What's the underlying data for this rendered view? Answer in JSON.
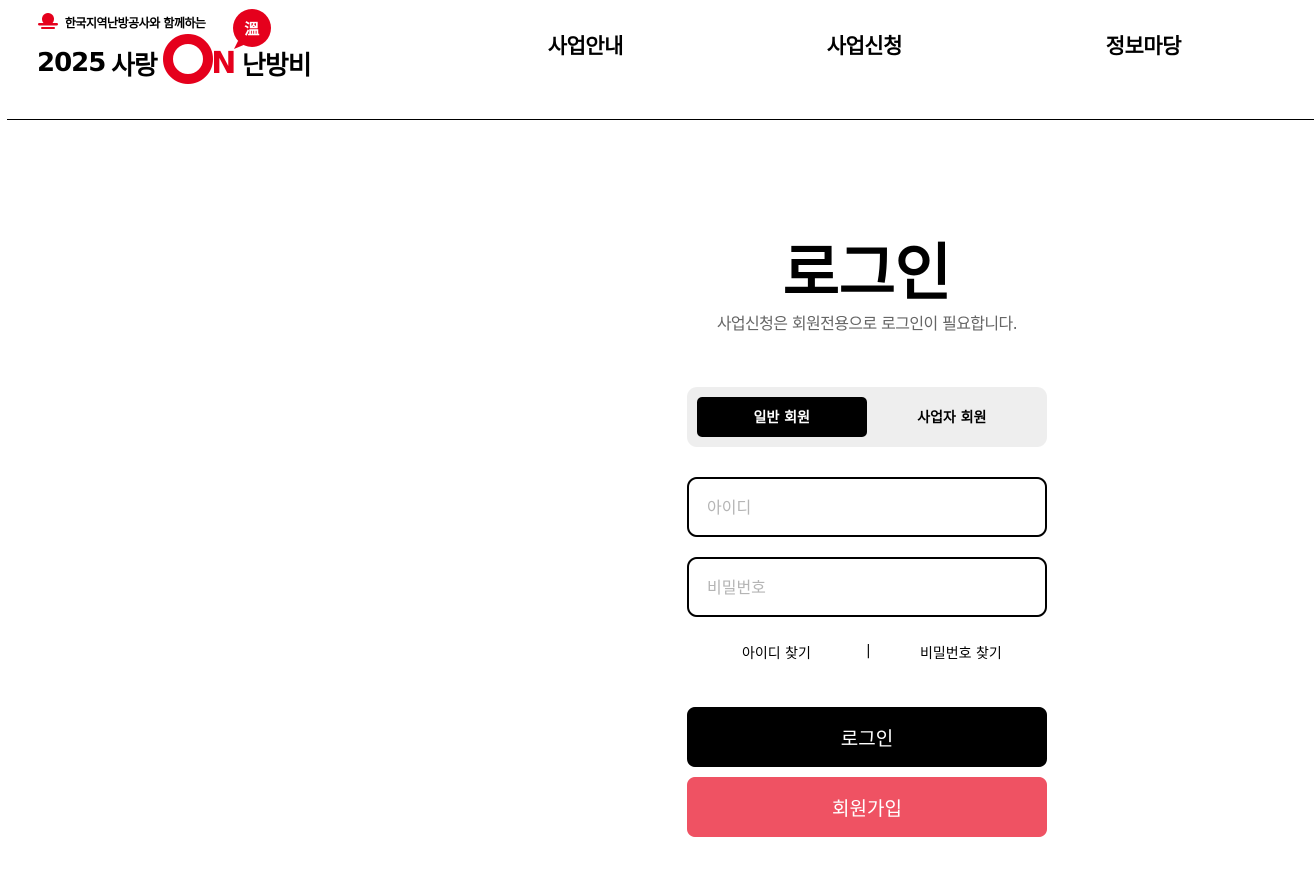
{
  "header": {
    "logo": {
      "subtitle": "한국지역난방공사와 함께하는",
      "year": "2025",
      "love": "사랑",
      "on_letter": "N",
      "heating": "난방비",
      "bubble_char": "溫",
      "brand_red": "#e5001c"
    },
    "nav": [
      {
        "label": "사업안내"
      },
      {
        "label": "사업신청"
      },
      {
        "label": "정보마당"
      }
    ]
  },
  "login": {
    "title": "로그인",
    "description": "사업신청은 회원전용으로 로그인이 필요합니다.",
    "tabs": [
      {
        "label": "일반 회원",
        "active": true
      },
      {
        "label": "사업자 회원",
        "active": false
      }
    ],
    "id_placeholder": "아이디",
    "pw_placeholder": "비밀번호",
    "find_id": "아이디 찾기",
    "separator": "|",
    "find_pw": "비밀번호 찾기",
    "login_button": "로그인",
    "join_button": "회원가입",
    "join_color": "#ef5263"
  }
}
